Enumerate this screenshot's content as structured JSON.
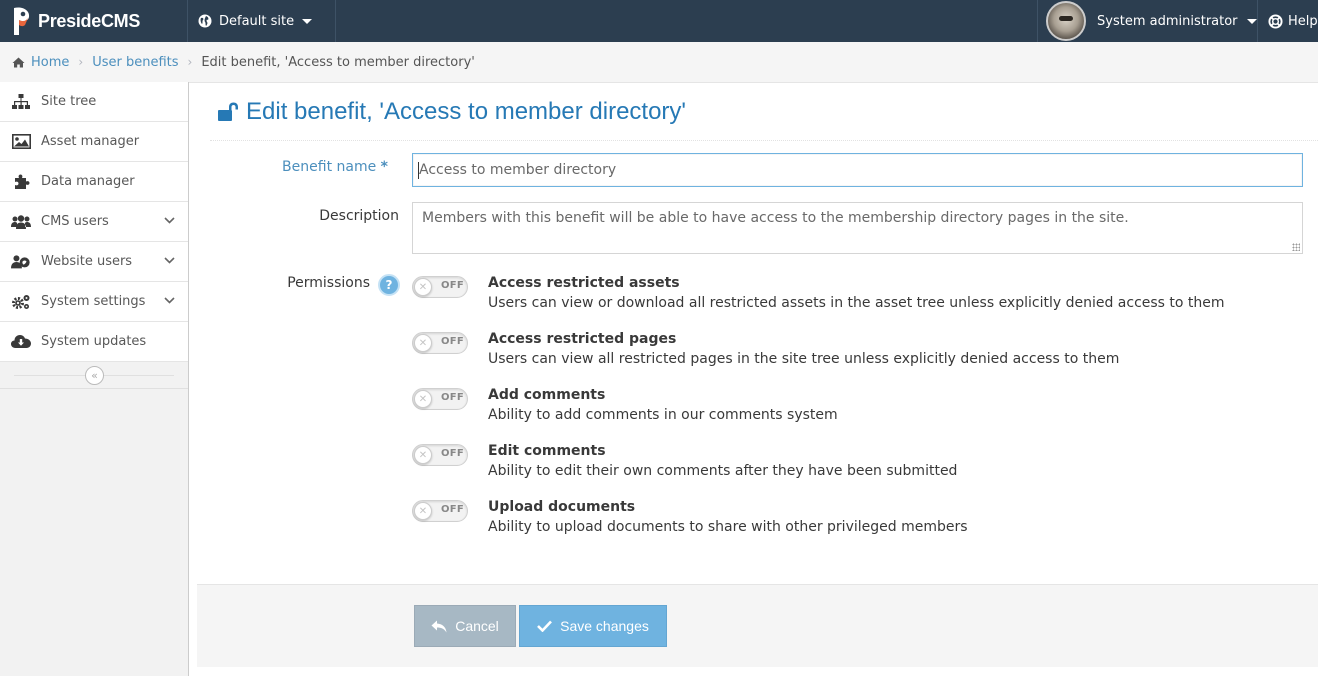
{
  "navbar": {
    "brand_main": "Preside",
    "brand_suffix": "CMS",
    "site": "Default site",
    "user": "System administrator",
    "help": "Help"
  },
  "breadcrumb": {
    "items": [
      "Home",
      "User benefits"
    ],
    "current": "Edit benefit, 'Access to member directory'"
  },
  "sidebar": {
    "items": [
      {
        "label": "Site tree",
        "icon": "sitemap-icon",
        "expandable": false
      },
      {
        "label": "Asset manager",
        "icon": "picture-icon",
        "expandable": false
      },
      {
        "label": "Data manager",
        "icon": "puzzle-icon",
        "expandable": false
      },
      {
        "label": "CMS users",
        "icon": "group-icon",
        "expandable": true
      },
      {
        "label": "Website users",
        "icon": "users-icon",
        "expandable": true
      },
      {
        "label": "System settings",
        "icon": "cogs-icon",
        "expandable": true
      },
      {
        "label": "System updates",
        "icon": "cloud-download-icon",
        "expandable": false
      }
    ]
  },
  "page": {
    "title": "Edit benefit, 'Access to member directory'"
  },
  "form": {
    "name_label": "Benefit name",
    "required_mark": "*",
    "name_value": "Access to member directory",
    "description_label": "Description",
    "description_value": "Members with this benefit will be able to have access to the membership directory pages in the site.",
    "permissions_label": "Permissions",
    "help_badge": "?",
    "toggle_off_text": "OFF",
    "permissions": [
      {
        "title": "Access restricted assets",
        "description": "Users can view or download all restricted assets in the asset tree unless explicitly denied access to them",
        "enabled": false
      },
      {
        "title": "Access restricted pages",
        "description": "Users can view all restricted pages in the site tree unless explicitly denied access to them",
        "enabled": false
      },
      {
        "title": "Add comments",
        "description": "Ability to add comments in our comments system",
        "enabled": false
      },
      {
        "title": "Edit comments",
        "description": "Ability to edit their own comments after they have been submitted",
        "enabled": false
      },
      {
        "title": "Upload documents",
        "description": "Ability to upload documents to share with other privileged members",
        "enabled": false
      }
    ],
    "cancel_label": "Cancel",
    "save_label": "Save changes"
  },
  "colors": {
    "navbar": "#2c3e50",
    "accent": "#2679b5",
    "link": "#4c8fbd",
    "save_button": "#6fb3e0",
    "cancel_button": "#a7b8c4"
  }
}
